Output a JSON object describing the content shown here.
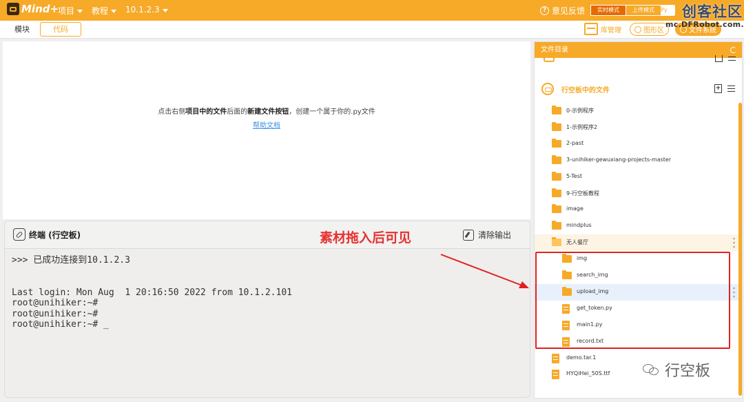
{
  "topbar": {
    "logo": "Mind+",
    "menu_project": "项目",
    "menu_tutorial": "教程",
    "menu_device": "10.1.2.3",
    "feedback": "意见反馈",
    "modes": [
      "实时模式",
      "上传模式",
      "Py"
    ],
    "watermark_cn": "创客社区",
    "watermark_url": "mc.DFRobot.com.cn"
  },
  "subbar": {
    "tab_blocks": "模块",
    "tab_code": "代码",
    "lib_manage": "库管理",
    "graphics": "图形区",
    "filesystem": "文件系统"
  },
  "editor": {
    "hint_a": "点击右侧",
    "hint_b": "项目中的文件",
    "hint_c": "后面的",
    "hint_d": "新建文件按钮",
    "hint_e": "，创建一个属于你的.py文件",
    "help_link": "帮助文档"
  },
  "terminal": {
    "title": "终端 (行空板)",
    "annotation": "素材拖入后可见",
    "clear": "清除输出",
    "lines": [
      ">>> 已成功连接到10.1.2.3",
      "",
      "",
      "Last login: Mon Aug  1 20:16:50 2022 from 10.1.2.101",
      "root@unihiker:~#",
      "root@unihiker:~#",
      "root@unihiker:~# _"
    ]
  },
  "filepanel": {
    "header": "文件目录",
    "board_title": "行空板中的文件",
    "items": [
      {
        "name": "0-示例程序",
        "type": "folder",
        "level": 0
      },
      {
        "name": "1-示例程序2",
        "type": "folder",
        "level": 0
      },
      {
        "name": "2-past",
        "type": "folder",
        "level": 0
      },
      {
        "name": "3-unihiker-gewuxiang-projects-master",
        "type": "folder",
        "level": 0
      },
      {
        "name": "5-Test",
        "type": "folder",
        "level": 0
      },
      {
        "name": "9-行空板教程",
        "type": "folder",
        "level": 0
      },
      {
        "name": "image",
        "type": "folder",
        "level": 0
      },
      {
        "name": "mindplus",
        "type": "folder",
        "level": 0
      },
      {
        "name": "无人餐厅",
        "type": "folder-open",
        "level": 0
      },
      {
        "name": "img",
        "type": "folder",
        "level": 1
      },
      {
        "name": "search_img",
        "type": "folder",
        "level": 1
      },
      {
        "name": "upload_img",
        "type": "folder",
        "level": 1
      },
      {
        "name": "get_token.py",
        "type": "file",
        "level": 1
      },
      {
        "name": "main1.py",
        "type": "file",
        "level": 1
      },
      {
        "name": "record.txt",
        "type": "file",
        "level": 1
      },
      {
        "name": "demo.tar.1",
        "type": "file",
        "level": 0
      },
      {
        "name": "HYQiHei_50S.ttf",
        "type": "file",
        "level": 0
      }
    ]
  },
  "wechat_watermark": "行空板",
  "colors": {
    "accent": "#f7a928",
    "annotation": "#e02020",
    "link": "#3a8ee6"
  }
}
